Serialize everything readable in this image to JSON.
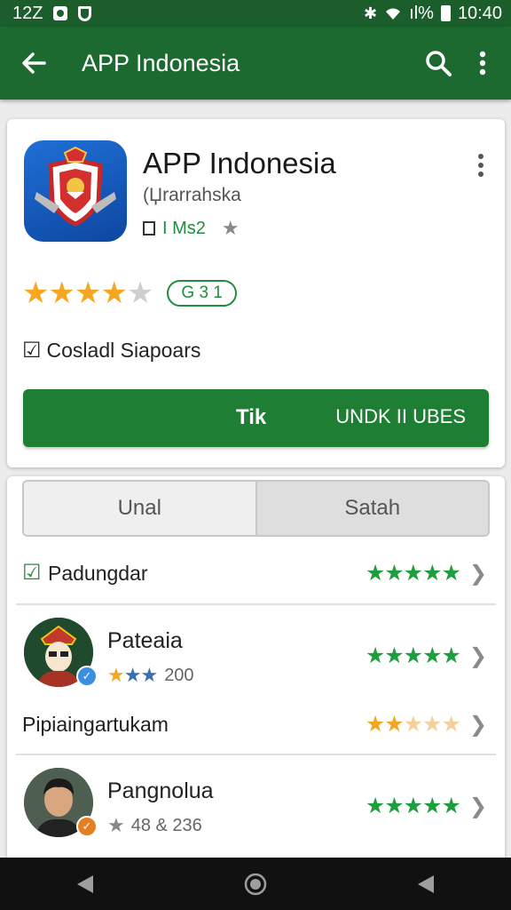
{
  "status_bar": {
    "left_time": "12Z",
    "right_signal": "ıl%",
    "right_time": "10:40"
  },
  "app_bar": {
    "title": "APP Indonesia"
  },
  "app": {
    "name": "APP Indonesia",
    "developer": "(Џrarrahska",
    "meta": "I Ms2",
    "rating_stars": 4,
    "rating_pill": "G 3 1",
    "checkbox_label": "Cosladl Siapoars",
    "install_left": "Tik",
    "install_right": "UNDK II UBES",
    "accent": "#1e7e34"
  },
  "segments": [
    "Unal",
    "Satah"
  ],
  "reviews": [
    {
      "label": "Padungdar",
      "stars": 5
    },
    {
      "name": "Pateaia",
      "stars": 5,
      "user_stars": 3,
      "count": "200"
    },
    {
      "label": "Pipiaingartukam",
      "stars": 2
    },
    {
      "name": "Pangnolua",
      "stars": 5,
      "count": "48 & 236"
    }
  ],
  "icons": [
    "back-arrow-icon",
    "search-icon",
    "more-vert-icon",
    "checkbox-icon",
    "chevron-right-icon",
    "nav-back-icon",
    "nav-home-icon",
    "nav-recent-icon"
  ]
}
